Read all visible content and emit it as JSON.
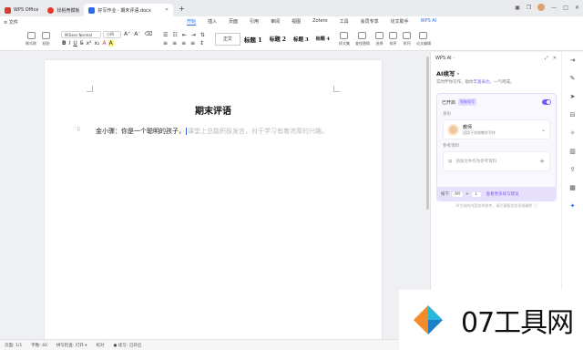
{
  "window": {
    "tabs": [
      {
        "label": "WPS Office",
        "color": "#d83b2f"
      },
      {
        "label": "找稻壳模板",
        "color": "#e23a2e"
      },
      {
        "label": "好写作业 - 期末评语.docx",
        "color": "#2b6de8"
      }
    ],
    "new_tab": "+"
  },
  "menubar": {
    "file": "≡ 文件",
    "items": [
      "开始",
      "插入",
      "页面",
      "引用",
      "审阅",
      "视图",
      "Zotero",
      "工具",
      "会员专享",
      "论文助手",
      "WPS AI"
    ],
    "active": "开始"
  },
  "ribbon": {
    "format_painter": "格式刷",
    "paste": "粘贴",
    "font_name": "MiSans Normal",
    "font_size": "小四",
    "styles": [
      "正文",
      "标题 1",
      "标题 2",
      "标题 3",
      "标题 4"
    ],
    "style_set": "样式集",
    "find_replace": "查找替换",
    "select": "选择",
    "sort": "排序",
    "layout": "排列",
    "doc_assist": "论文编辑"
  },
  "document": {
    "title": "期末评语",
    "text_typed": "金小骤：你是一个聪明的孩子，",
    "text_ghost": "课堂上总能积极发言，对于学习有着浓厚的兴趣。"
  },
  "ai_panel": {
    "header": "WPS AI ·",
    "title": "AI续写 ·",
    "subtitle_prefix": "实时伴你写作，助你",
    "subtitle_highlight": "丰富表达",
    "subtitle_suffix": "，一气呵成。",
    "enabled_label": "已开启",
    "enabled_tag": "智能续写",
    "role_section": "身份",
    "role_name": "教师",
    "role_desc": "适用于学校教学写作",
    "ref_section": "参考资料",
    "ref_placeholder": "添加文件作为参考资料",
    "gen_prefix": "按下",
    "gen_key": "Alt",
    "gen_mid": "+",
    "gen_key2": "↓",
    "gen_suffix": "查看更多续写建议",
    "disclaimer": "AI生成的内容仅供参考，请注意甄别信息准确性 ⓘ"
  },
  "statusbar": {
    "page": "页面: 1/1",
    "words": "字数: 40",
    "spell": "拼写检查: 打开 ▾",
    "proof": "校对",
    "mode": "● 续写: 已开启"
  },
  "watermark": {
    "text": "07工具网"
  }
}
